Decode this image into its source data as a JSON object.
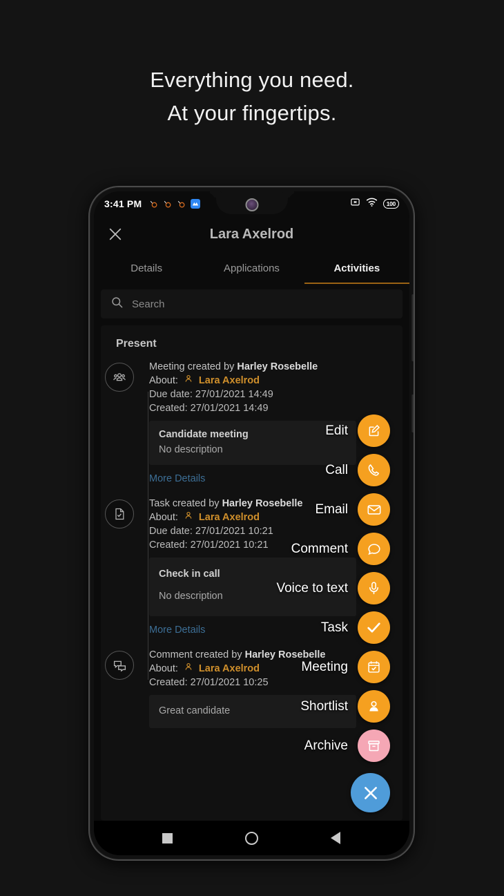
{
  "headline": {
    "line1": "Everything you need.",
    "line2": "At your fingertips."
  },
  "status_bar": {
    "time": "3:41 PM",
    "battery": "100",
    "icons": [
      "notification-icon",
      "notification-icon",
      "notification-icon",
      "app-icon",
      "no-sim-icon",
      "wifi-icon",
      "battery-icon"
    ]
  },
  "app_bar": {
    "close_label": "close-icon",
    "title": "Lara Axelrod"
  },
  "tabs": [
    {
      "label": "Details",
      "active": false
    },
    {
      "label": "Applications",
      "active": false
    },
    {
      "label": "Activities",
      "active": true
    }
  ],
  "search": {
    "placeholder": "Search",
    "value": ""
  },
  "section": {
    "title": "Present"
  },
  "timeline": [
    {
      "icon": "group-icon",
      "created_by_prefix": "Meeting created by ",
      "created_by": "Harley Rosebelle",
      "about_label": "About:",
      "about_name": "Lara Axelrod",
      "due_date": "Due date: 27/01/2021 14:49",
      "created": "Created: 27/01/2021 14:49",
      "card_title": "Candidate meeting",
      "card_desc": "No description",
      "more": "More Details"
    },
    {
      "icon": "task-document-icon",
      "created_by_prefix": "Task created by ",
      "created_by": "Harley Rosebelle",
      "about_label": "About:",
      "about_name": "Lara Axelrod",
      "due_date": "Due date: 27/01/2021 10:21",
      "created": "Created: 27/01/2021 10:21",
      "card_title": "Check in call",
      "card_desc": "No description",
      "more": "More Details"
    },
    {
      "icon": "chat-bubbles-icon",
      "created_by_prefix": "Comment created by ",
      "created_by": "Harley Rosebelle",
      "about_label": "About:",
      "about_name": "Lara Axelrod",
      "due_date": "",
      "created": "Created: 27/01/2021 10:25",
      "card_title": "",
      "card_desc": "Great candidate",
      "more": ""
    }
  ],
  "fab_menu": [
    {
      "label": "Edit",
      "icon": "edit-icon",
      "color": "#F5A020"
    },
    {
      "label": "Call",
      "icon": "phone-icon",
      "color": "#F5A020"
    },
    {
      "label": "Email",
      "icon": "envelope-icon",
      "color": "#F5A020"
    },
    {
      "label": "Comment",
      "icon": "comment-icon",
      "color": "#F5A020"
    },
    {
      "label": "Voice to text",
      "icon": "mic-icon",
      "color": "#F5A020"
    },
    {
      "label": "Task",
      "icon": "check-icon",
      "color": "#F5A020"
    },
    {
      "label": "Meeting",
      "icon": "calendar-check-icon",
      "color": "#F5A020"
    },
    {
      "label": "Shortlist",
      "icon": "person-icon",
      "color": "#F5A020"
    },
    {
      "label": "Archive",
      "icon": "archive-icon",
      "color": "#F5A7B5"
    }
  ],
  "fab_main": {
    "icon": "close-icon",
    "color": "#4F9CD9"
  },
  "nav_bar": {
    "recents": "square-icon",
    "home": "circle-icon",
    "back": "triangle-back-icon"
  },
  "colors": {
    "accent_orange": "#F5A020",
    "accent_pink": "#F5A7B5",
    "accent_blue": "#4F9CD9",
    "tab_underline": "#9A6214",
    "link_blue": "#3D6F96",
    "name_gold": "#CF8F2B"
  }
}
